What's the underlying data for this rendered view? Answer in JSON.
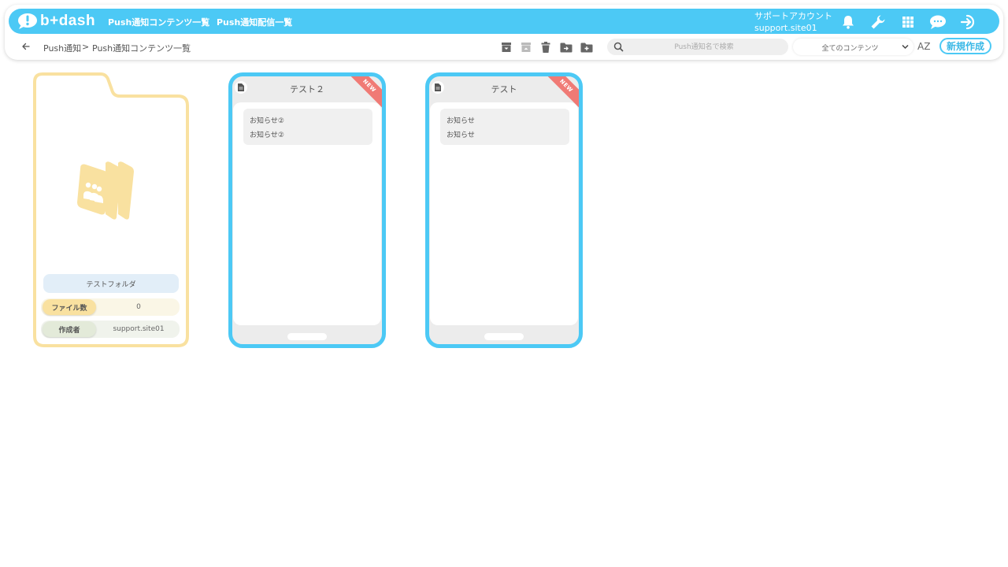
{
  "header": {
    "logo_text": "b+dash",
    "nav": [
      "Push通知コンテンツ一覧",
      "Push通知配信一覧"
    ],
    "account_line1": "サポートアカウント",
    "account_line2": "support.site01",
    "icons": [
      "bell-icon",
      "wrench-icon",
      "grid-icon",
      "chat-bubble-icon",
      "logout-icon"
    ]
  },
  "breadcrumb": {
    "back_icon": "arrow-left-icon",
    "items": [
      "Push通知",
      ">",
      "Push通知コンテンツ一覧"
    ]
  },
  "toolbar": {
    "icons": [
      "archive-icon",
      "unarchive-icon",
      "trash-icon",
      "move-folder-icon",
      "new-folder-icon"
    ],
    "search_placeholder": "Push通知名で検索",
    "filter_value": "全てのコンテンツ",
    "sort_label": "AZ",
    "new_button": "新規作成"
  },
  "folder": {
    "name": "テストフォルダ",
    "file_count_label": "ファイル数",
    "file_count": "0",
    "creator_label": "作成者",
    "creator": "support.site01"
  },
  "cards": [
    {
      "title": "テスト２",
      "badge": "NEW",
      "line1": "お知らせ②",
      "line2": "お知らせ②"
    },
    {
      "title": "テスト",
      "badge": "NEW",
      "line1": "お知らせ",
      "line2": "お知らせ"
    }
  ],
  "colors": {
    "accent": "#4cc9f5",
    "folder": "#f9e1a0",
    "badge": "#f07a75"
  }
}
